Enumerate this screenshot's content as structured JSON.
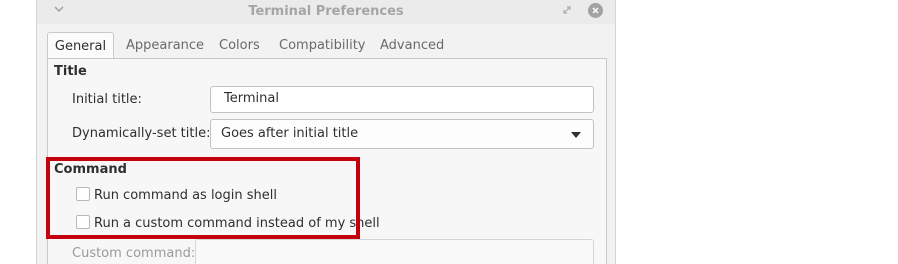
{
  "window": {
    "title": "Terminal Preferences"
  },
  "tabs": [
    {
      "label": "General",
      "active": true
    },
    {
      "label": "Appearance",
      "active": false
    },
    {
      "label": "Colors",
      "active": false
    },
    {
      "label": "Compatibility",
      "active": false
    },
    {
      "label": "Advanced",
      "active": false
    }
  ],
  "title_section": {
    "heading": "Title",
    "initial_title_label": "Initial title:",
    "initial_title_value": "Terminal",
    "dynamic_title_label": "Dynamically-set title:",
    "dynamic_title_value": "Goes after initial title"
  },
  "command_section": {
    "heading": "Command",
    "login_shell_label": "Run command as login shell",
    "login_shell_checked": false,
    "custom_command_label": "Run a custom command instead of my shell",
    "custom_command_checked": false,
    "custom_command_field_label": "Custom command:",
    "custom_command_value": ""
  },
  "icons": {
    "window_menu": "chevron-down-icon",
    "restore": "restore-icon",
    "close": "close-icon",
    "dropdown": "dropdown-arrow-icon"
  },
  "colors": {
    "highlight_border": "#c4000f"
  }
}
